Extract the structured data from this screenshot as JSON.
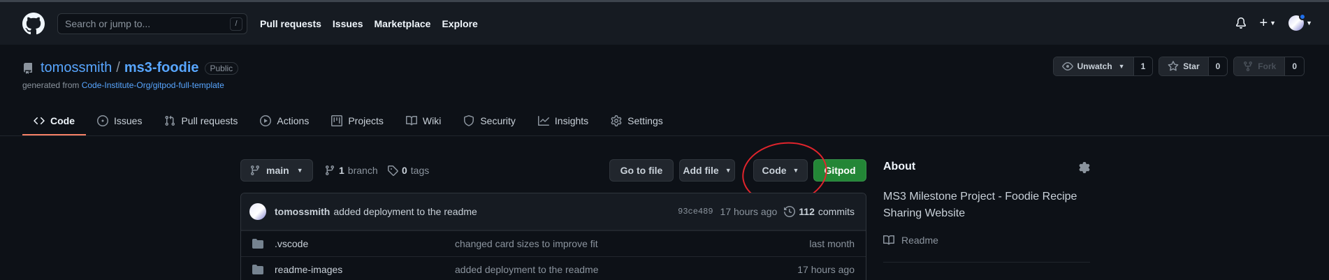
{
  "header": {
    "search_placeholder": "Search or jump to...",
    "search_shortcut": "/",
    "nav": [
      "Pull requests",
      "Issues",
      "Marketplace",
      "Explore"
    ],
    "plus_label": "+"
  },
  "repo": {
    "owner": "tomossmith",
    "separator": "/",
    "name": "ms3-foodie",
    "visibility": "Public",
    "generated_prefix": "generated from ",
    "generated_link": "Code-Institute-Org/gitpod-full-template",
    "watch_label": "Unwatch",
    "watch_count": "1",
    "star_label": "Star",
    "star_count": "0",
    "fork_label": "Fork",
    "fork_count": "0"
  },
  "tabs": [
    {
      "label": "Code",
      "icon": "code-icon",
      "active": true
    },
    {
      "label": "Issues",
      "icon": "issue-icon"
    },
    {
      "label": "Pull requests",
      "icon": "pull-request-icon"
    },
    {
      "label": "Actions",
      "icon": "play-icon"
    },
    {
      "label": "Projects",
      "icon": "project-icon"
    },
    {
      "label": "Wiki",
      "icon": "book-icon"
    },
    {
      "label": "Security",
      "icon": "shield-icon"
    },
    {
      "label": "Insights",
      "icon": "graph-icon"
    },
    {
      "label": "Settings",
      "icon": "gear-icon"
    }
  ],
  "filenav": {
    "branch": "main",
    "branch_count": "1",
    "branch_word": "branch",
    "tag_count": "0",
    "tag_word": "tags",
    "goto_file": "Go to file",
    "add_file": "Add file",
    "code": "Code",
    "gitpod": "Gitpod"
  },
  "latest_commit": {
    "author": "tomossmith",
    "message": "added deployment to the readme",
    "sha": "93ce489",
    "time": "17 hours ago",
    "commit_count": "112",
    "commit_word": "commits"
  },
  "files": [
    {
      "name": ".vscode",
      "message": "changed card sizes to improve fit",
      "age": "last month"
    },
    {
      "name": "readme-images",
      "message": "added deployment to the readme",
      "age": "17 hours ago"
    }
  ],
  "about": {
    "title": "About",
    "description": "MS3 Milestone Project - Foodie Recipe Sharing Website",
    "readme": "Readme"
  },
  "colors": {
    "accent": "#58a6ff",
    "green": "#238636",
    "annotation": "#e0242c",
    "tab_underline": "#f78166"
  }
}
